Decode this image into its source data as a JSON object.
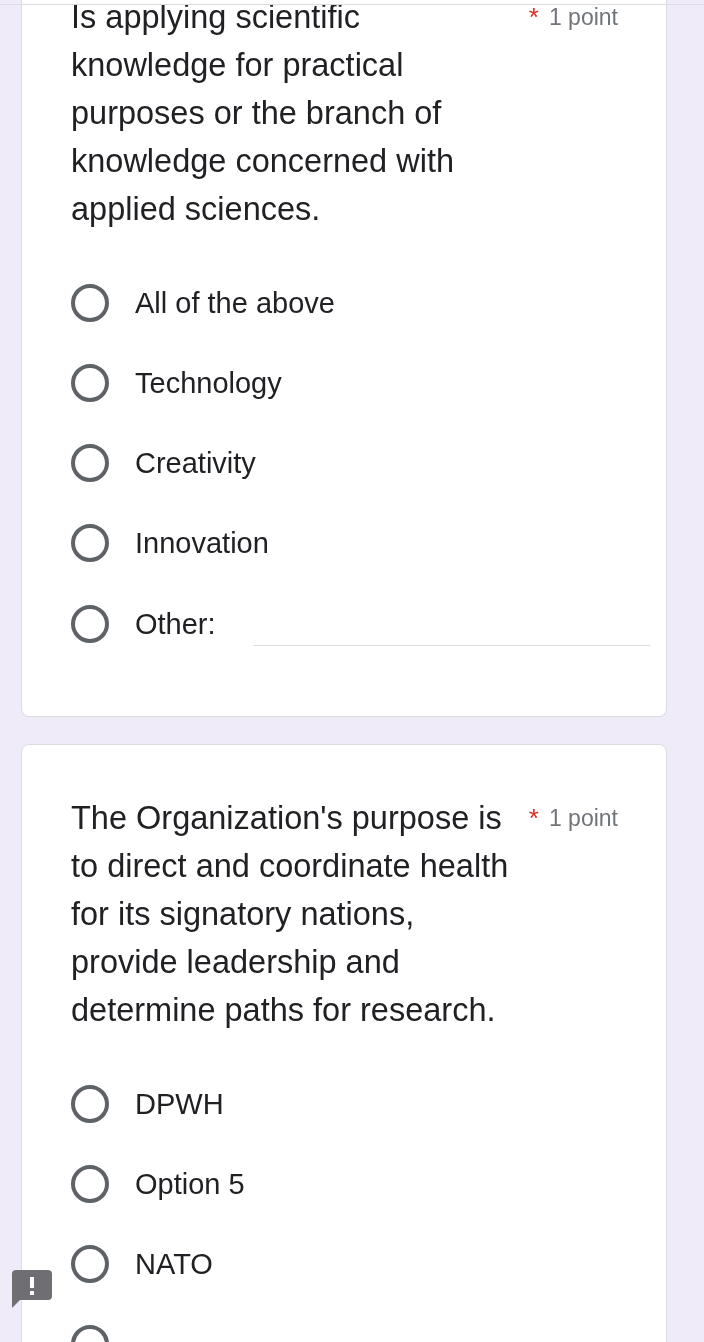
{
  "questions": [
    {
      "text": "Is applying scientific knowledge for practical purposes or the branch of knowledge concerned with applied sciences.",
      "required": true,
      "required_mark": "*",
      "points": "1 point",
      "options": [
        {
          "kind": "choice",
          "label": "All of the above",
          "selected": false
        },
        {
          "kind": "choice",
          "label": "Technology",
          "selected": false
        },
        {
          "kind": "choice",
          "label": "Creativity",
          "selected": false
        },
        {
          "kind": "choice",
          "label": "Innovation",
          "selected": false
        },
        {
          "kind": "other",
          "label": "Other:",
          "selected": false
        }
      ]
    },
    {
      "text": "The Organization's purpose is to direct and coordinate health for its signatory nations, provide leadership and determine paths for research.",
      "required": true,
      "required_mark": "*",
      "points": "1 point",
      "options": [
        {
          "kind": "choice",
          "label": "DPWH",
          "selected": false
        },
        {
          "kind": "choice",
          "label": "Option 5",
          "selected": false
        },
        {
          "kind": "choice",
          "label": "NATO",
          "selected": false
        },
        {
          "kind": "choice",
          "selected": false
        }
      ]
    }
  ]
}
